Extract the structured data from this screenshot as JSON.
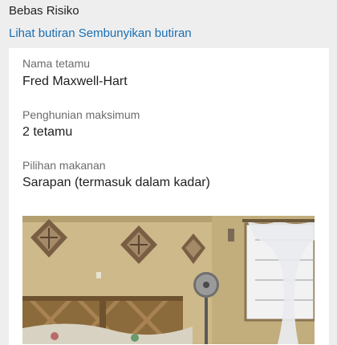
{
  "header": {
    "risk_label": "Bebas Risiko",
    "show_details_link": "Lihat butiran",
    "hide_details_link": "Sembunyikan butiran"
  },
  "details": {
    "guest_name_label": "Nama tetamu",
    "guest_name_value": "Fred Maxwell-Hart",
    "max_occupancy_label": "Penghunian maksimum",
    "max_occupancy_value": "2 tetamu",
    "meal_option_label": "Pilihan makanan",
    "meal_option_value": "Sarapan (termasuk dalam kadar)"
  },
  "colors": {
    "link": "#1a6fb5",
    "background": "#eeeeee",
    "card": "#ffffff"
  }
}
